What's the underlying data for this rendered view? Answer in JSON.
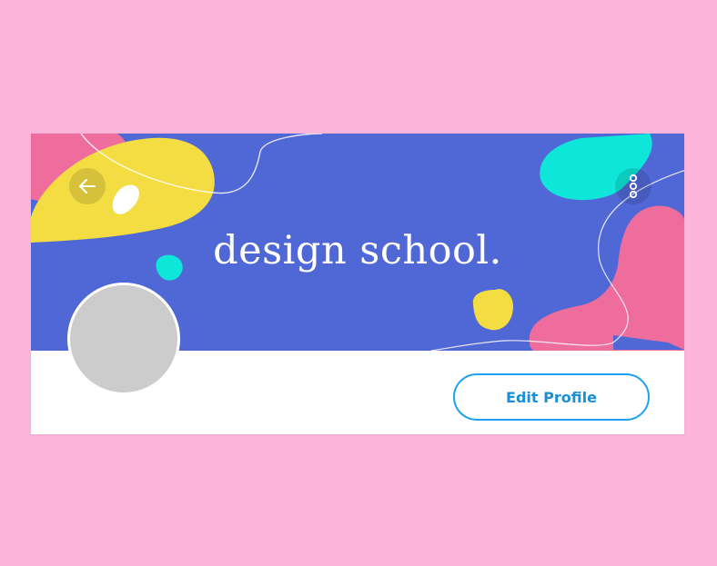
{
  "banner": {
    "title": "design school.",
    "colors": {
      "background": "#5068d6",
      "pink": "#ee6d9c",
      "yellow": "#f3dd43",
      "cyan": "#0fe6da"
    }
  },
  "header": {
    "back_icon": "arrow-left-icon",
    "more_icon": "more-vertical-icon"
  },
  "profile": {
    "avatar_color": "#cccccc",
    "edit_label": "Edit Profile",
    "accent": "#1da1f2"
  },
  "page": {
    "background": "#fdb4da"
  }
}
